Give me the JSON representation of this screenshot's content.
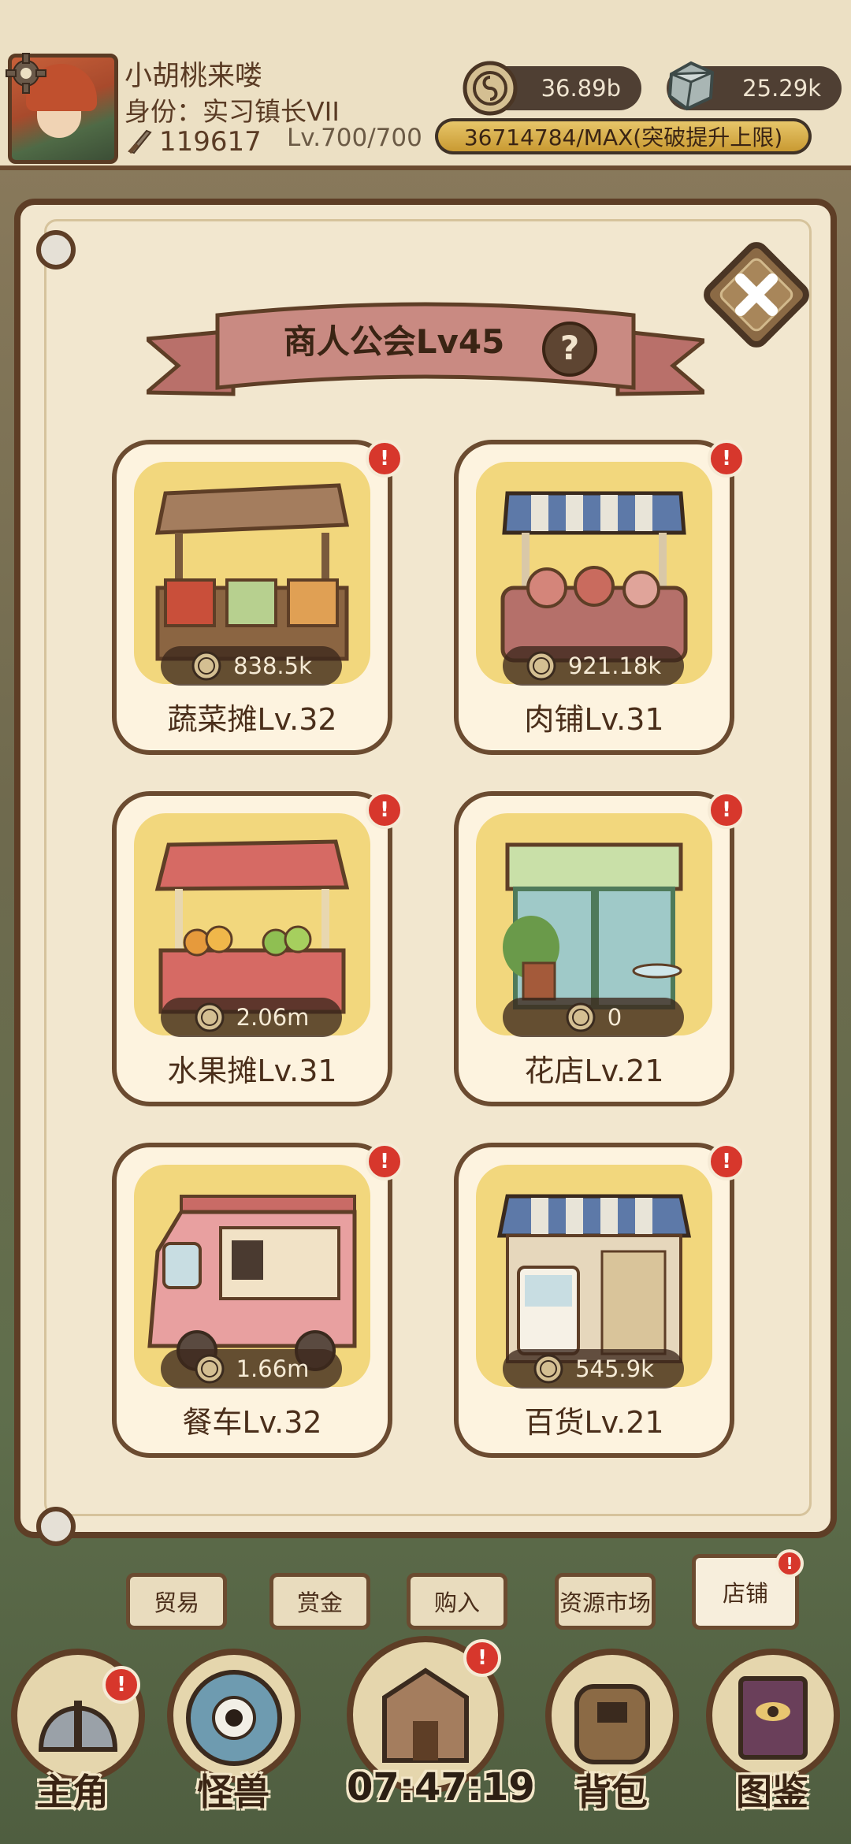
{
  "player": {
    "name": "小胡桃来喽",
    "role": "身份：实习镇长VII",
    "power": "119617",
    "level": "Lv.700/700",
    "coins": "36.89b",
    "gems": "25.29k",
    "exp_text": "36714784/MAX(突破提升上限)",
    "exp_progress": 1.0
  },
  "panel": {
    "title": "商人公会Lv45",
    "help_label": "?"
  },
  "shops": [
    {
      "label": "蔬菜摊Lv.32",
      "value": "838.5k",
      "icon": "vegetable-stall",
      "badge": "!"
    },
    {
      "label": "肉铺Lv.31",
      "value": "921.18k",
      "icon": "butcher-shop",
      "badge": "!"
    },
    {
      "label": "水果摊Lv.31",
      "value": "2.06m",
      "icon": "fruit-stall",
      "badge": "!"
    },
    {
      "label": "花店Lv.21",
      "value": "0",
      "icon": "flower-shop",
      "badge": "!"
    },
    {
      "label": "餐车Lv.32",
      "value": "1.66m",
      "icon": "food-truck",
      "badge": "!"
    },
    {
      "label": "百货Lv.21",
      "value": "545.9k",
      "icon": "department-store",
      "badge": "!"
    }
  ],
  "tabs": [
    {
      "label": "贸易"
    },
    {
      "label": "赏金"
    },
    {
      "label": "购入"
    },
    {
      "label": "资源市场"
    },
    {
      "label": "店铺",
      "active": true,
      "badge": "!"
    }
  ],
  "nav": [
    {
      "label": "主角",
      "icon": "helmet-icon",
      "badge": "!"
    },
    {
      "label": "怪兽",
      "icon": "monster-eye-icon",
      "badge": ""
    },
    {
      "label": "",
      "icon": "town-icon",
      "badge": "!"
    },
    {
      "label": "背包",
      "icon": "backpack-icon",
      "badge": ""
    },
    {
      "label": "图鉴",
      "icon": "codex-book-icon",
      "badge": ""
    }
  ],
  "timer": "07:47:19",
  "colors": {
    "frame": "#5e3e26",
    "parchment": "#f2e7cf",
    "card_fill": "#f2d77d",
    "badge": "#d7372c"
  }
}
